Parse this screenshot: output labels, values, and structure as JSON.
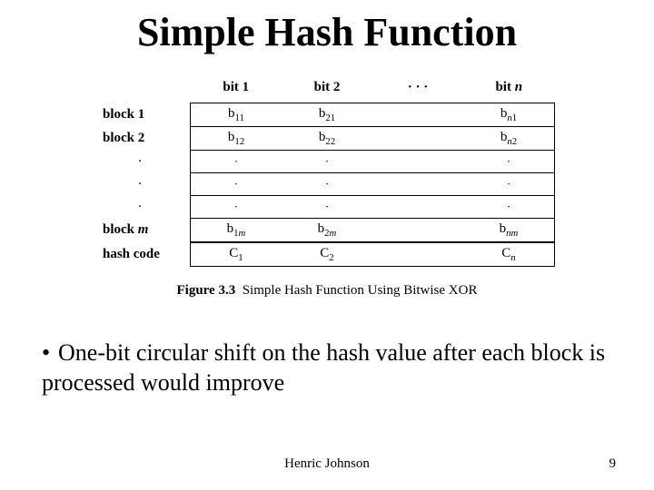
{
  "title": "Simple Hash Function",
  "table": {
    "headers": {
      "bit1": "bit 1",
      "bit2": "bit 2",
      "dots": "·   ·   ·",
      "bitn_prefix": "bit ",
      "bitn_var": "n"
    },
    "rows": {
      "block1": {
        "label": "block 1",
        "c1_base": "b",
        "c1_sub": "11",
        "c2_base": "b",
        "c2_sub": "21",
        "cn_base": "b",
        "cn_sub_var": "n",
        "cn_sub_num": "1"
      },
      "block2": {
        "label": "block 2",
        "c1_base": "b",
        "c1_sub": "12",
        "c2_base": "b",
        "c2_sub": "22",
        "cn_base": "b",
        "cn_sub_var": "n",
        "cn_sub_num": "2"
      },
      "dot": "·",
      "blockm": {
        "label_prefix": "block ",
        "label_var": "m",
        "c1_base": "b",
        "c1_num": "1",
        "c1_var": "m",
        "c2_base": "b",
        "c2_num": "2",
        "c2_var": "m",
        "cn_base": "b",
        "cn_var1": "n",
        "cn_var2": "m"
      },
      "hash": {
        "label": "hash code",
        "c1_base": "C",
        "c1_sub": "1",
        "c2_base": "C",
        "c2_sub": "2",
        "cn_base": "C",
        "cn_sub_var": "n"
      }
    }
  },
  "caption": {
    "num": "Figure 3.3",
    "text": "Simple Hash Function Using Bitwise XOR"
  },
  "bullet": "One-bit circular shift on the hash value after each block is processed would improve",
  "footer": {
    "author": "Henric Johnson",
    "page": "9"
  }
}
